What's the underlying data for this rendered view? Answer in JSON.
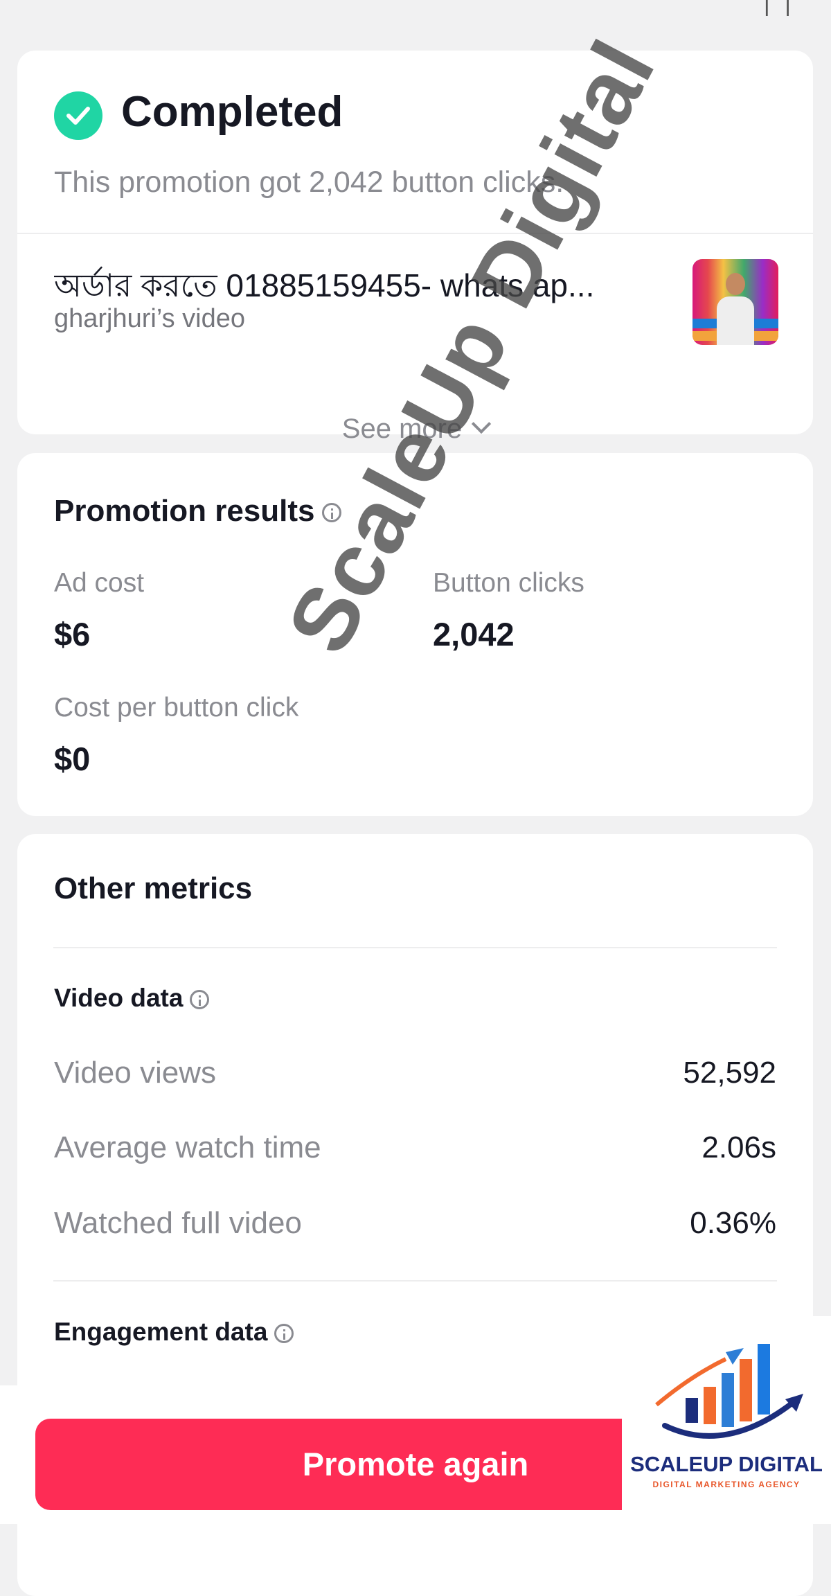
{
  "status": {
    "title": "Completed",
    "subtitle": "This promotion got 2,042 button clicks.",
    "video_title": "অর্ডার করতে 01885159455- whats ap...",
    "video_owner": "gharjhuri’s video",
    "see_more": "See more",
    "icons": {
      "check": "check-circle-icon",
      "chevron": "chevron-down-icon"
    }
  },
  "promotion_results": {
    "title": "Promotion results",
    "stats": [
      {
        "label": "Ad cost",
        "value": "$6"
      },
      {
        "label": "Button clicks",
        "value": "2,042"
      },
      {
        "label": "Cost per button click",
        "value": "$0"
      }
    ]
  },
  "other_metrics": {
    "title": "Other metrics",
    "video_data": {
      "title": "Video data",
      "rows": [
        {
          "label": "Video views",
          "value": "52,592"
        },
        {
          "label": "Average watch time",
          "value": "2.06s"
        },
        {
          "label": "Watched full video",
          "value": "0.36%"
        }
      ]
    },
    "engagement_data": {
      "title": "Engagement data"
    }
  },
  "footer": {
    "promote_again": "Promote again"
  },
  "watermark": {
    "text": "ScaleUp Digital"
  },
  "logo": {
    "name": "SCALEUP DIGITAL",
    "tagline": "DIGITAL MARKETING AGENCY"
  },
  "colors": {
    "accent": "#fe2c55",
    "success": "#20d5a4",
    "background": "#f1f1f2"
  }
}
